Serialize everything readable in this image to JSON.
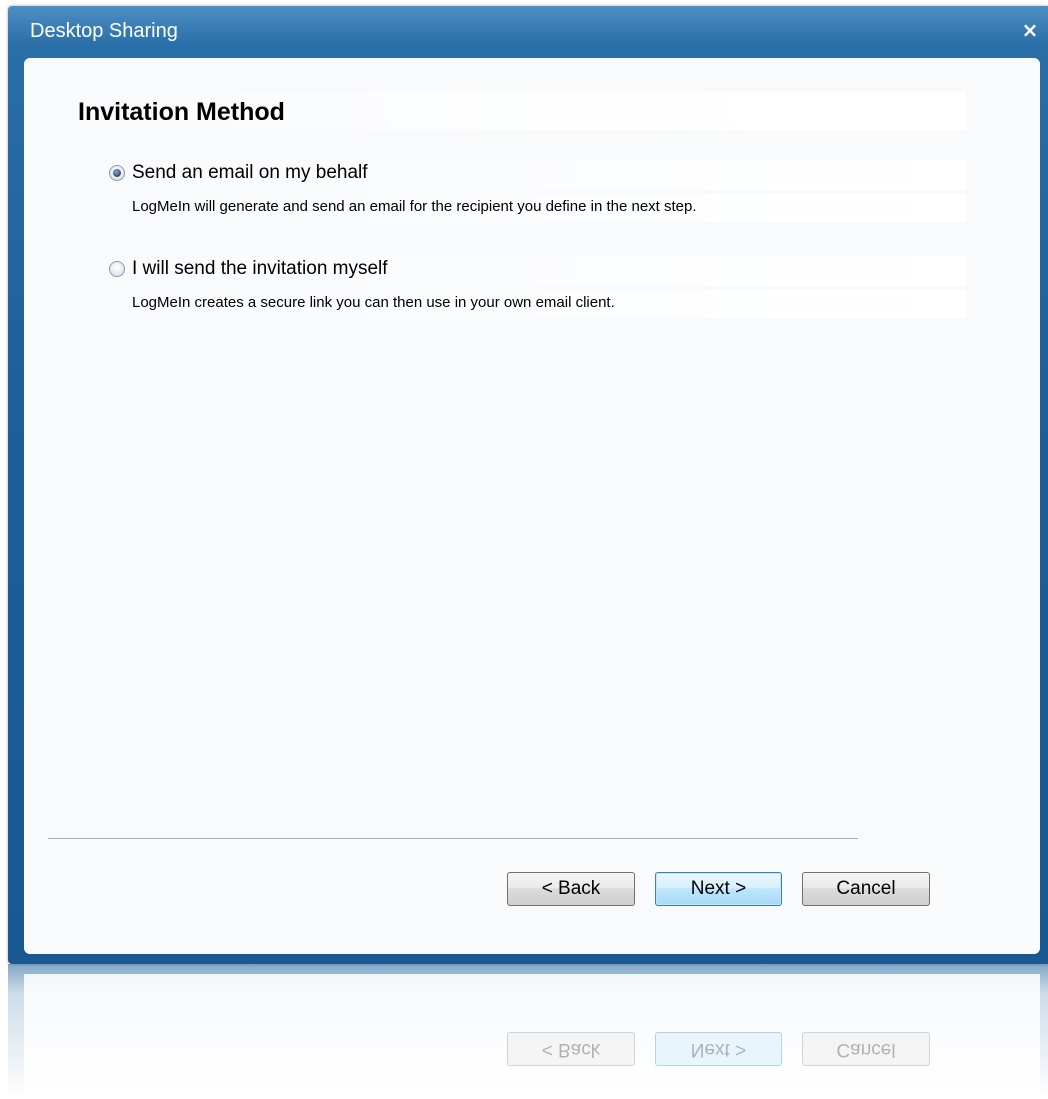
{
  "window": {
    "title": "Desktop Sharing",
    "close_glyph": "×"
  },
  "page": {
    "heading": "Invitation Method"
  },
  "options": [
    {
      "label": "Send an email on my behalf",
      "description": "LogMeIn will generate and send an email for the recipient you define in the next step.",
      "selected": true
    },
    {
      "label": "I will send the invitation myself",
      "description": "LogMeIn creates a secure link you can then use in your own email client.",
      "selected": false
    }
  ],
  "buttons": {
    "back_label": "< Back",
    "next_label": "Next >",
    "cancel_label": "Cancel"
  },
  "colors": {
    "titlebar": "#2a6ea7",
    "content_bg": "#f8fafc",
    "default_button": "#bee6fd"
  },
  "icons": {
    "close": "close-icon",
    "radio_checked": "radio-checked-icon",
    "radio_unchecked": "radio-unchecked-icon"
  }
}
